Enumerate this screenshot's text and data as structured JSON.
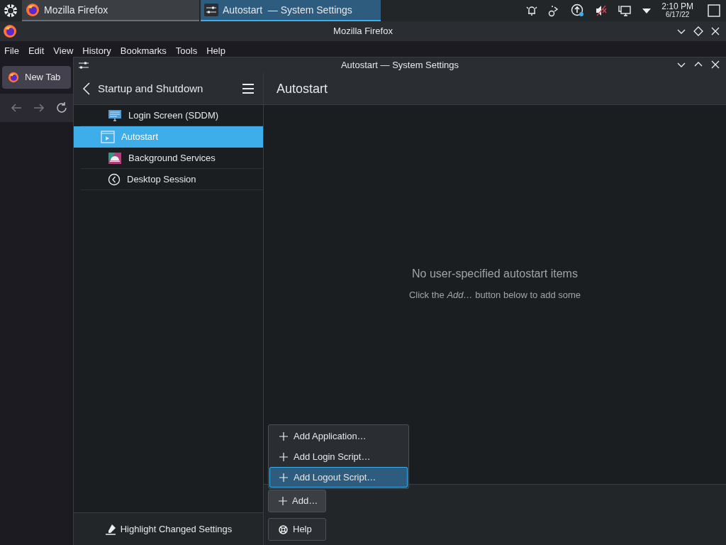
{
  "taskbar": {
    "tasks": [
      {
        "title": "Mozilla Firefox",
        "selected": false
      },
      {
        "title": "Autostart  — System Settings",
        "selected": true
      }
    ],
    "clock": {
      "time": "2:10 PM",
      "date": "6/17/22"
    }
  },
  "firefox": {
    "title": "Mozilla Firefox",
    "menu": [
      "File",
      "Edit",
      "View",
      "History",
      "Bookmarks",
      "Tools",
      "Help"
    ],
    "tab": "New Tab"
  },
  "settings": {
    "title": "Autostart — System Settings",
    "sidebar": {
      "title": "Startup and Shutdown",
      "items": [
        {
          "label": "Login Screen (SDDM)",
          "selected": false
        },
        {
          "label": "Autostart",
          "selected": true
        },
        {
          "label": "Background Services",
          "selected": false
        },
        {
          "label": "Desktop Session",
          "selected": false
        }
      ],
      "footer_button": "Highlight Changed Settings"
    },
    "page": {
      "title": "Autostart",
      "empty_title": "No user-specified autostart items",
      "empty_hint": "Click the *Add…* button below to add some"
    },
    "add_menu": [
      {
        "label": "Add Application…",
        "selected": false
      },
      {
        "label": "Add Login Script…",
        "selected": false
      },
      {
        "label": "Add Logout Script…",
        "selected": true
      }
    ],
    "buttons": [
      "Add…",
      "Help"
    ]
  }
}
